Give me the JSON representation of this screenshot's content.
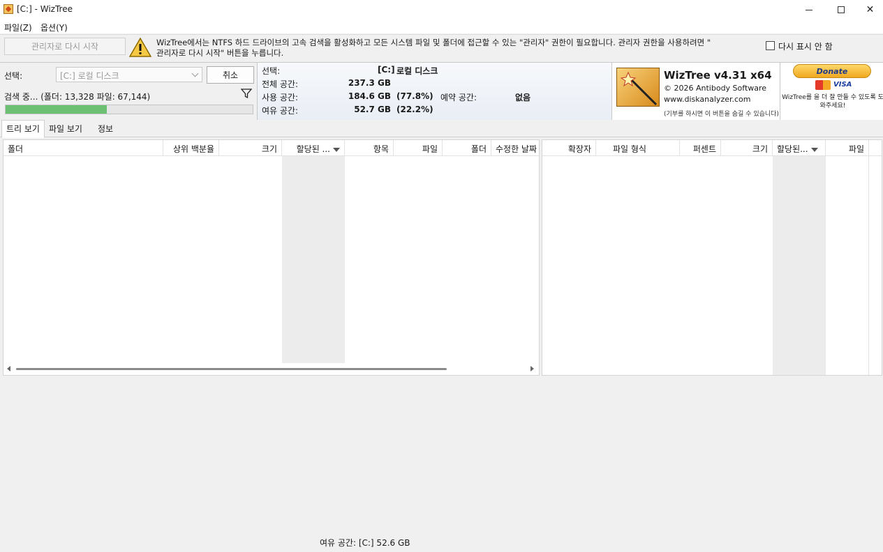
{
  "window": {
    "title": "[C:]  - WizTree",
    "minimize_icon": "minimize-icon",
    "maximize_icon": "maximize-icon",
    "close_glyph": "✕"
  },
  "menu": {
    "file": "파일(Z)",
    "options": "옵션(Y)"
  },
  "admin_bar": {
    "restart_button": "관리자로 다시 시작",
    "warning_line1": "WizTree에서는 NTFS 하드 드라이브의 고속 검색을 활성화하고 모든 시스템 파일 및 폴더에 접근할 수 있는 \"관리자\" 권한이 필요합니다. 관리자 권한을 사용하려면 \"",
    "warning_line2": "관리자로 다시 시작\" 버튼을 누릅니다.",
    "dont_show_label": "다시 표시 안 함",
    "dont_show_checked": false
  },
  "scan": {
    "select_label": "선택:",
    "drive_value": "[C:] 로컬 디스크",
    "cancel_button": "취소",
    "status_text": "검색 중... (폴더: 13,328  파일: 67,144)",
    "progress_fraction": 0.41
  },
  "drive_info": {
    "select_label": "선택:",
    "drive_letter": "[C:]",
    "drive_name": "로컬 디스크",
    "total_label": "전체 공간:",
    "total_value": "237.3 GB",
    "used_label": "사용 공간:",
    "used_value": "184.6 GB",
    "used_pct": "(77.8%)",
    "reserved_label": "예약 공간:",
    "reserved_value": "없음",
    "free_label": "여유 공간:",
    "free_value": "52.7 GB",
    "free_pct": "(22.2%)"
  },
  "brand": {
    "title": "WizTree v4.31 x64",
    "copyright": "© 2026 Antibody Software",
    "url": "www.diskanalyzer.com",
    "note": "(기부를 하시면 이 버튼을 숨길 수 있습니다)"
  },
  "donate": {
    "button": "Donate",
    "visa": "VISA",
    "note": "WizTree를 을 더 잘 만들 수 있도록 도와주세요!"
  },
  "tabs": [
    {
      "label": "트리 보기",
      "active": true
    },
    {
      "label": "파일 보기",
      "active": false
    },
    {
      "label": "정보",
      "active": false
    }
  ],
  "tree_columns": [
    "폴더",
    "상위 백분율",
    "크기",
    "할당된 ...",
    "항목",
    "파일",
    "폴더",
    "수정한 날짜"
  ],
  "ext_columns": [
    "확장자",
    "파일 형식",
    "퍼센트",
    "크기",
    "할당된...",
    "파일"
  ],
  "status": {
    "free_space": "여유 공간: [C:] 52.6 GB"
  },
  "colors": {
    "progress": "#6cc072",
    "accent_donate": "#f0a820"
  }
}
